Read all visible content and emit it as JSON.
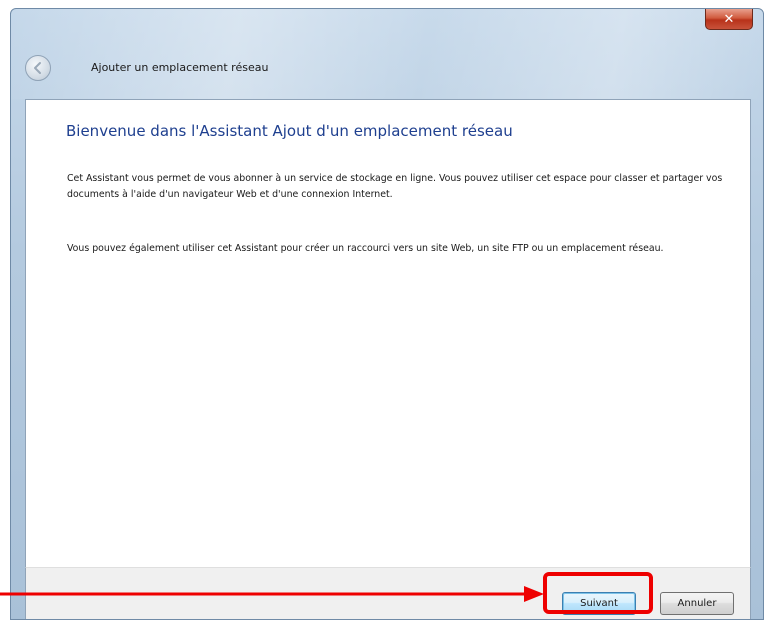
{
  "window": {
    "title": "Ajouter un emplacement réseau",
    "close_label": "✕"
  },
  "content": {
    "heading": "Bienvenue dans l'Assistant Ajout d'un emplacement réseau",
    "paragraph1": "Cet Assistant vous permet de vous abonner à un service de stockage en ligne. Vous pouvez utiliser cet espace pour classer et partager vos documents à l'aide d'un navigateur Web et d'une connexion Internet.",
    "paragraph2": "Vous pouvez également utiliser cet Assistant pour créer un raccourci vers un site Web, un site FTP ou un emplacement réseau."
  },
  "footer": {
    "next_label": "Suivant",
    "cancel_label": "Annuler"
  },
  "annotation": {
    "color": "#ee0000",
    "target": "next-button"
  },
  "icons": [
    "back-arrow-icon",
    "close-icon"
  ]
}
